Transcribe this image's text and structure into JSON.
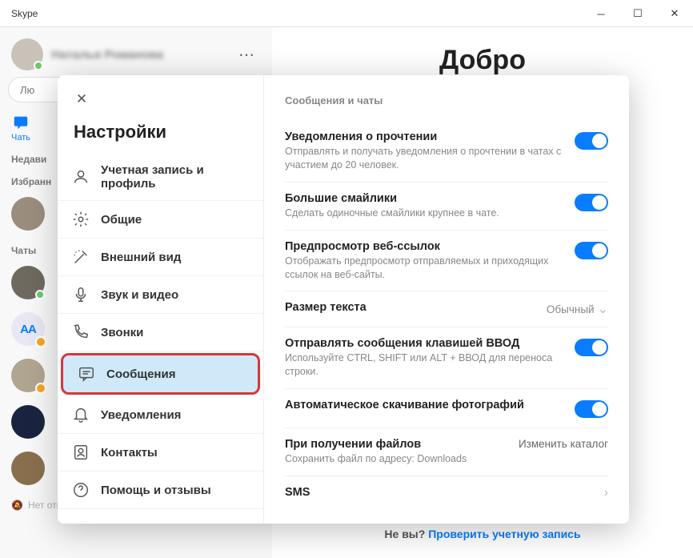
{
  "window": {
    "title": "Skype"
  },
  "profile": {
    "name": "Наталья Романова"
  },
  "search": {
    "placeholder": "Лю"
  },
  "tabs": {
    "chats": "Чать"
  },
  "sections": {
    "recent": "Недави",
    "favorites": "Избранн",
    "chats": "Чаты",
    "no_answer": "Нет ответа"
  },
  "main": {
    "welcome": "Добро",
    "not_you": "Не вы?",
    "check_account": "Проверить учетную запись"
  },
  "settings": {
    "title": "Настройки",
    "nav": {
      "account": "Учетная запись и профиль",
      "general": "Общие",
      "appearance": "Внешний вид",
      "audio": "Звук и видео",
      "calls": "Звонки",
      "messages": "Сообщения",
      "notifications": "Уведомления",
      "contacts": "Контакты",
      "help": "Помощь и отзывы"
    },
    "panel": {
      "section": "Сообщения и чаты",
      "read_receipts": {
        "label": "Уведомления о прочтении",
        "desc": "Отправлять и получать уведомления о прочтении в чатах с участием до 20 человек."
      },
      "large_emoji": {
        "label": "Большие смайлики",
        "desc": "Сделать одиночные смайлики крупнее в чате."
      },
      "link_preview": {
        "label": "Предпросмотр веб-ссылок",
        "desc": "Отображать предпросмотр отправляемых и приходящих ссылок на веб-сайты."
      },
      "text_size": {
        "label": "Размер текста",
        "value": "Обычный"
      },
      "send_enter": {
        "label": "Отправлять сообщения клавишей ВВОД",
        "desc": "Используйте CTRL, SHIFT или ALT + ВВОД для переноса строки."
      },
      "auto_download": {
        "label": "Автоматическое скачивание фотографий"
      },
      "file_receive": {
        "label": "При получении файлов",
        "desc": "Сохранить файл по адресу: Downloads",
        "action": "Изменить каталог"
      },
      "sms": {
        "label": "SMS"
      }
    }
  }
}
